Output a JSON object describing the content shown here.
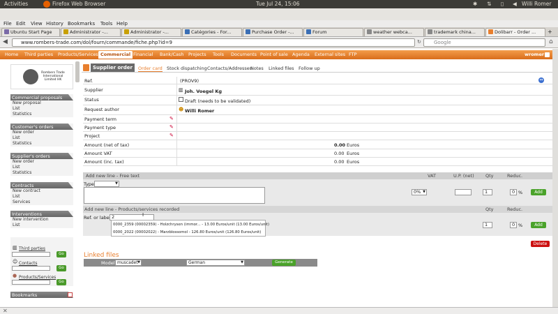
{
  "ubuntu": {
    "activities": "Activities",
    "app": "Firefox Web Browser",
    "clock": "Tue Jul 24, 15:06",
    "user": "Willi Romer"
  },
  "firefox": {
    "menu": [
      "File",
      "Edit",
      "View",
      "History",
      "Bookmarks",
      "Tools",
      "Help"
    ],
    "tabs": [
      "Ubuntu Start Page",
      "Administrator -...",
      "Administrator -...",
      "Catégories - For...",
      "Purchase Order -...",
      "Forum",
      "weather webca...",
      "trademark china...",
      "Dolibarr - Order ..."
    ],
    "url": "www.rombers-trade.com/dol/fourn/commande/fiche.php?id=9",
    "search_placeholder": "Google"
  },
  "dolimenu": {
    "items": [
      "Home",
      "Third parties",
      "Products/Services",
      "Commercial",
      "Financial",
      "Bank/Cash",
      "Projects",
      "Tools",
      "Documents",
      "Point of sale",
      "Agenda",
      "External sites",
      "FTP"
    ],
    "user": "wromer"
  },
  "sidebar": {
    "logo_text": "Rombers Trade International Limited HK",
    "sections": [
      {
        "title": "Commercial proposals",
        "items": [
          "New proposal",
          "List",
          "Statistics"
        ]
      },
      {
        "title": "Customer's orders",
        "items": [
          "New order",
          "List",
          "Statistics"
        ]
      },
      {
        "title": "Supplier's orders",
        "items": [
          "New order",
          "List",
          "Statistics"
        ]
      },
      {
        "title": "Contracts",
        "items": [
          "New contract",
          "List",
          "Services"
        ]
      },
      {
        "title": "Interventions",
        "items": [
          "New intervention",
          "List"
        ]
      }
    ],
    "search": {
      "third_parties": "Third parties",
      "contacts": "Contacts",
      "products": "Products/Services",
      "go": "Go"
    },
    "bookmarks": "Bookmarks"
  },
  "order": {
    "title": "Supplier order",
    "tabs": [
      "Order card",
      "Stock dispatching",
      "Contacts/Addresses",
      "Notes",
      "Linked files",
      "Follow up"
    ],
    "fields": {
      "ref_label": "Ref.",
      "ref": "(PROV9)",
      "supplier_label": "Supplier",
      "supplier": "Joh. Voegel Kg",
      "status_label": "Status",
      "status": "Draft (needs to be validated)",
      "author_label": "Request author",
      "author": "Willi Romer",
      "payment_term_label": "Payment term",
      "payment_type_label": "Payment type",
      "project_label": "Project",
      "net_label": "Amount (net of tax)",
      "net": "0.00",
      "vat_label": "Amount VAT",
      "vat": "0.00",
      "inc_label": "Amount (inc. tax)",
      "inc": "0.00",
      "currency": "Euros"
    },
    "free_line": {
      "header": "Add new line - Free text",
      "vat_h": "VAT",
      "up_h": "U.P. (net)",
      "qty_h": "Qty",
      "reduc_h": "Reduc.",
      "type_label": "Type:",
      "vat_value": "0%",
      "qty": "1",
      "reduc": "0",
      "pct": "%",
      "add": "Add"
    },
    "product_line": {
      "header": "Add new line - Products/services recorded",
      "qty_h": "Qty",
      "reduc_h": "Reduc.",
      "ref_label": "Ref. or label :",
      "ref_value": "2",
      "qty": "1",
      "reduc": "0",
      "pct": "%",
      "add": "Add"
    },
    "suggestions": [
      "0000_2359 (00002359) - Holzchrysen (immor... - 13.00 Euros/unit (13.00 Euros/unit)",
      "0000_2022 (00002022) - Marzblossomol - 126.80 Euros/unit (126.80 Euros/unit)"
    ],
    "delete": "Delete",
    "linked": {
      "title": "Linked files",
      "model_label": "Model",
      "model": "muscadet",
      "lang": "German",
      "generate": "Generate"
    }
  },
  "colors": {
    "accent": "#e87f2e",
    "add": "#4aa22a",
    "delete": "#cc1111"
  }
}
